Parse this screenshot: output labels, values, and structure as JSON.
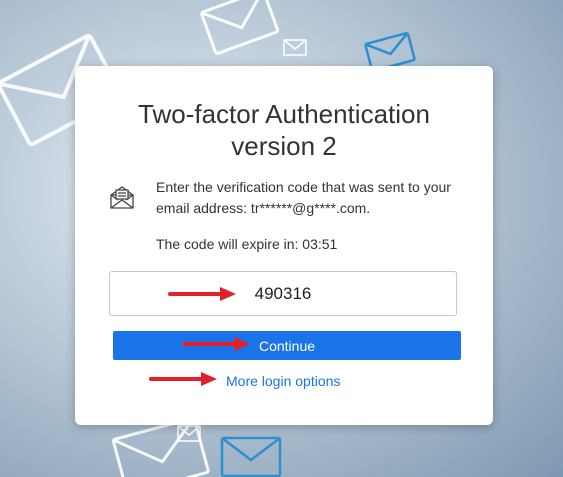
{
  "card": {
    "title_line1": "Two-factor Authentication",
    "title_line2": "version 2",
    "info_text": "Enter the verification code that was sent to your email address: tr******@g****.com.",
    "expire_label": "The code will expire in: 03:51"
  },
  "form": {
    "code_value": "490316",
    "continue_label": "Continue",
    "more_options_label": "More login options"
  },
  "icons": {
    "info_icon": "open-envelope-with-letter-icon",
    "arrow_icon": "red-arrow-icon"
  },
  "colors": {
    "accent": "#1a73e8",
    "arrow": "#e0202a",
    "text": "#333333"
  }
}
